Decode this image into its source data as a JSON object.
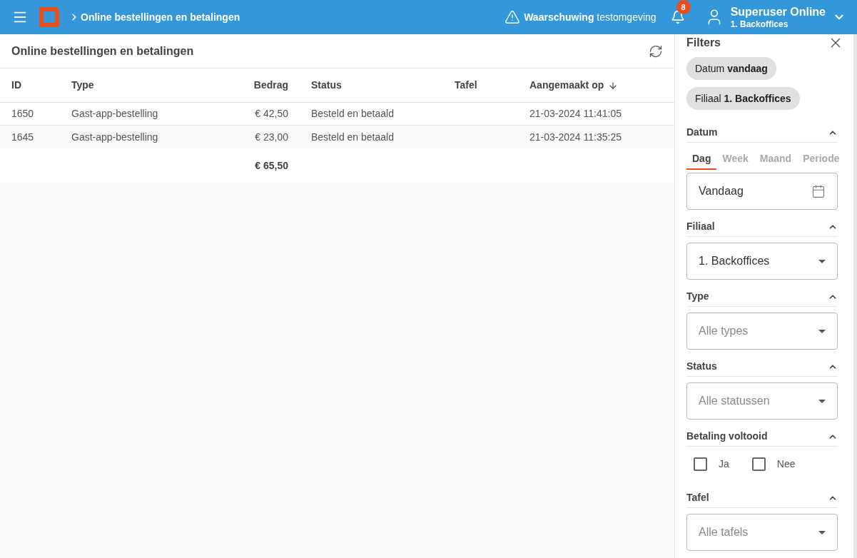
{
  "header": {
    "breadcrumb": "Online bestellingen en betalingen",
    "warning": "**Waarschuwing** testomgeving",
    "notifications": "8",
    "user": {
      "name": "Superuser Online",
      "branch": "1. Backoffices"
    }
  },
  "page": {
    "title": "Online bestellingen en betalingen",
    "table": {
      "columns": [
        {
          "label": "ID",
          "sorted": false
        },
        {
          "label": "Type",
          "sorted": false
        },
        {
          "label": "Bedrag",
          "sorted": false
        },
        {
          "label": "Status",
          "sorted": false
        },
        {
          "label": "Tafel",
          "sorted": false
        },
        {
          "label": "Aangemaakt op",
          "sorted": true
        }
      ],
      "rows": [
        {
          "cells": [
            "1650",
            "Gast-app-bestelling",
            "€ 42,50",
            "Besteld en betaald",
            "",
            "21-03-2024 11:41:05"
          ]
        },
        {
          "cells": [
            "1645",
            "Gast-app-bestelling",
            "€ 23,00",
            "Besteld en betaald",
            "",
            "21-03-2024 11:35:25"
          ]
        }
      ],
      "total": "€ 65,50"
    }
  },
  "filters": {
    "title": "Filters",
    "chips": [
      "Datum **vandaag**",
      "Filiaal **1. Backoffices**"
    ],
    "sections": [
      {
        "kind": "date",
        "title": "Datum",
        "expanded": true,
        "tabs": [
          {
            "label": "Dag",
            "selected": true
          },
          {
            "label": "Week",
            "selected": false
          },
          {
            "label": "Maand",
            "selected": false
          },
          {
            "label": "Periode",
            "selected": false
          }
        ],
        "value": "Vandaag"
      },
      {
        "kind": "select",
        "title": "Filiaal",
        "expanded": true,
        "value": "1. Backoffices"
      },
      {
        "kind": "select",
        "title": "Type",
        "expanded": true,
        "placeholder": "Alle types"
      },
      {
        "kind": "select",
        "title": "Status",
        "expanded": true,
        "placeholder": "Alle statussen"
      },
      {
        "kind": "checkboxes",
        "title": "Betaling voltooid",
        "expanded": true,
        "options": [
          {
            "label": "Ja",
            "checked": false
          },
          {
            "label": "Nee",
            "checked": false
          }
        ]
      },
      {
        "kind": "select",
        "title": "Tafel",
        "expanded": true,
        "placeholder": "Alle tafels"
      }
    ]
  }
}
